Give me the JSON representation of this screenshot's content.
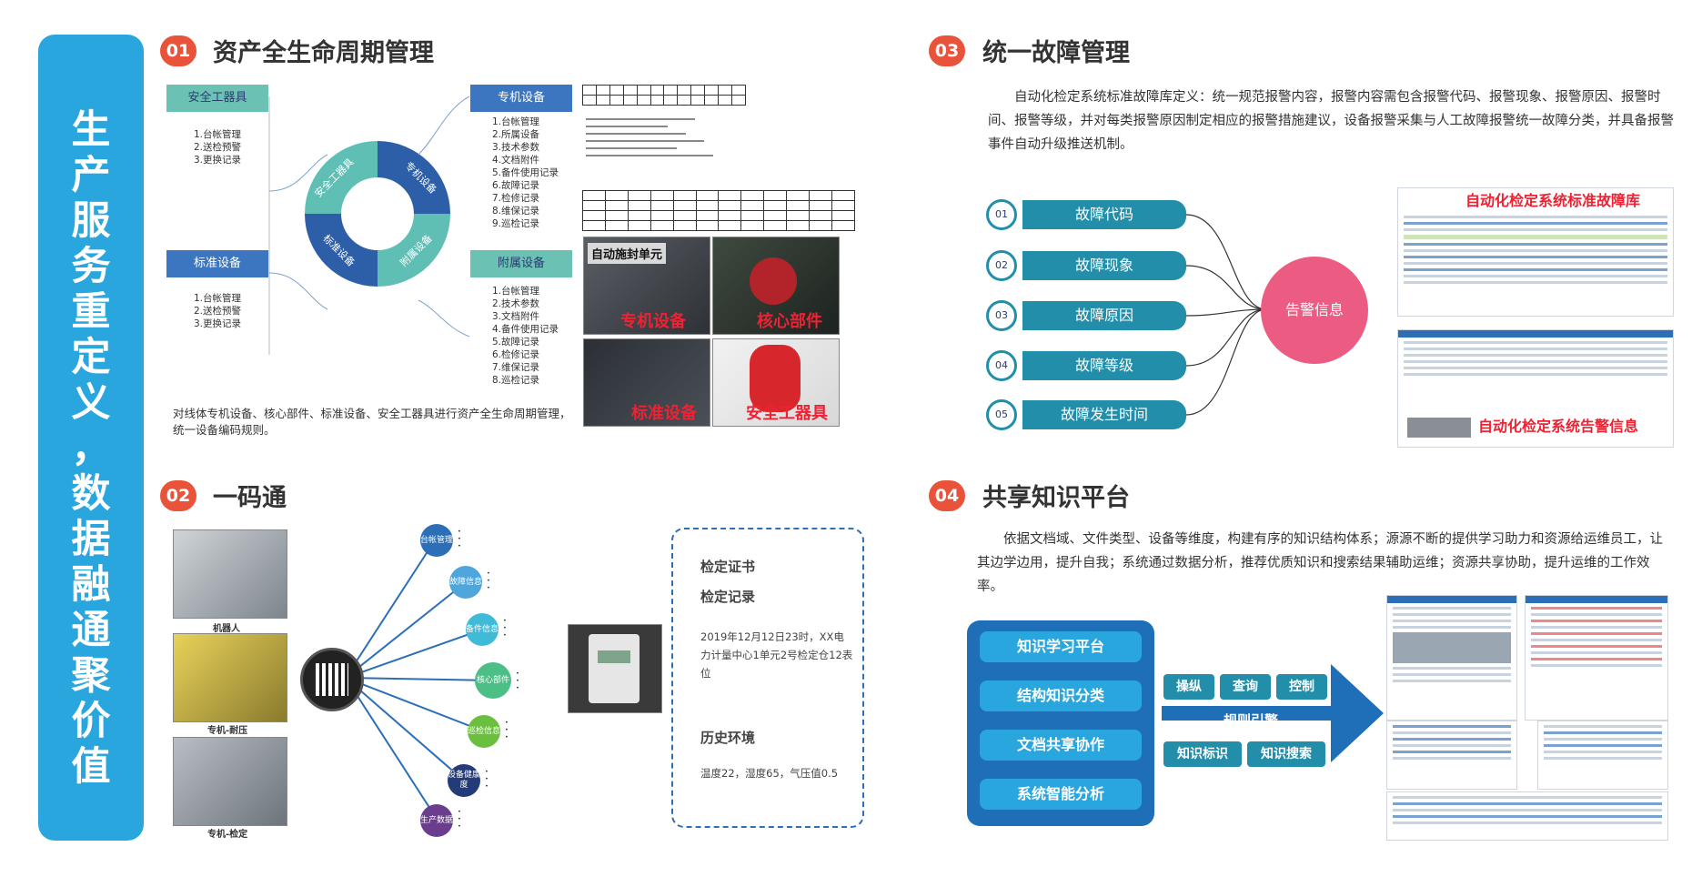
{
  "banner": {
    "text": "生产服务重定义，数据融通聚价值"
  },
  "sections": {
    "s1": {
      "num": "01",
      "title": "资产全生命周期管理"
    },
    "s2": {
      "num": "02",
      "title": "一码通"
    },
    "s3": {
      "num": "03",
      "title": "统一故障管理"
    },
    "s4": {
      "num": "04",
      "title": "共享知识平台"
    }
  },
  "s1": {
    "categories": [
      {
        "head": "安全工器具",
        "items": [
          "1.台帐管理",
          "2.送检预警",
          "3.更换记录"
        ]
      },
      {
        "head": "专机设备",
        "items": [
          "1.台帐管理",
          "2.所属设备",
          "3.技术参数",
          "4.文档附件",
          "5.备件使用记录",
          "6.故障记录",
          "7.检修记录",
          "8.维保记录",
          "9.巡检记录"
        ]
      },
      {
        "head": "标准设备",
        "items": [
          "1.台帐管理",
          "2.送检预警",
          "3.更换记录"
        ]
      },
      {
        "head": "附属设备",
        "items": [
          "1.台帐管理",
          "2.技术参数",
          "3.文档附件",
          "4.备件使用记录",
          "5.故障记录",
          "6.检修记录",
          "7.维保记录",
          "8.巡检记录"
        ]
      }
    ],
    "ring_labels": [
      "安全工器具",
      "专机设备",
      "附属设备",
      "标准设备"
    ],
    "photos": [
      "专机设备",
      "核心部件",
      "标准设备",
      "安全工器具"
    ],
    "photo_sign": "自动施封单元",
    "desc": "对线体专机设备、核心部件、标准设备、安全工器具进行资产全生命周期管理，统一设备编码规则。"
  },
  "s2": {
    "photos": [
      "机器人",
      "专机-耐压",
      "专机-检定"
    ],
    "nodes": [
      "台帐管理",
      "故障信息",
      "备件信息",
      "核心部件",
      "巡检信息",
      "设备健康度",
      "生产数据"
    ],
    "cert": {
      "line1": "检定证书",
      "line2": "检定记录",
      "record": "2019年12月12日23时，XX电力计量中心1单元2号检定仓12表位",
      "env_title": "历史环境",
      "env": "温度22，湿度65，气压值0.5"
    }
  },
  "s3": {
    "desc": "自动化检定系统标准故障库定义：统一规范报警内容，报警内容需包含报警代码、报警现象、报警原因、报警时间、报警等级，并对每类报警原因制定相应的报警措施建议，设备报警采集与人工故障报警统一故障分类，并具备报警事件自动升级推送机制。",
    "faults": [
      {
        "num": "01",
        "label": "故障代码"
      },
      {
        "num": "02",
        "label": "故障现象"
      },
      {
        "num": "03",
        "label": "故障原因"
      },
      {
        "num": "04",
        "label": "故障等级"
      },
      {
        "num": "05",
        "label": "故障发生时间"
      }
    ],
    "alarm": "告警信息",
    "screen1_title": "自动化检定系统标准故障库",
    "screen2_title": "自动化检定系统告警信息"
  },
  "s4": {
    "desc": "依据文档域、文件类型、设备等维度，构建有序的知识结构体系；源源不断的提供学习助力和资源给运维员工，让其边学边用，提升自我；系统通过数据分析，推荐优质知识和搜索结果辅助运维；资源共享协助，提升运维的工作效率。",
    "buttons": [
      "知识学习平台",
      "结构知识分类",
      "文档共享协作",
      "系统智能分析"
    ],
    "tags_top": [
      "操纵",
      "查询",
      "控制"
    ],
    "engine": "规则引擎",
    "tags_bottom": [
      "知识标识",
      "知识搜索"
    ]
  },
  "colors": {
    "banner": "#2aa6df",
    "accent": "#e8533a",
    "teal": "#238ea9",
    "pink": "#ec5b82",
    "navy": "#1e6fb8"
  }
}
